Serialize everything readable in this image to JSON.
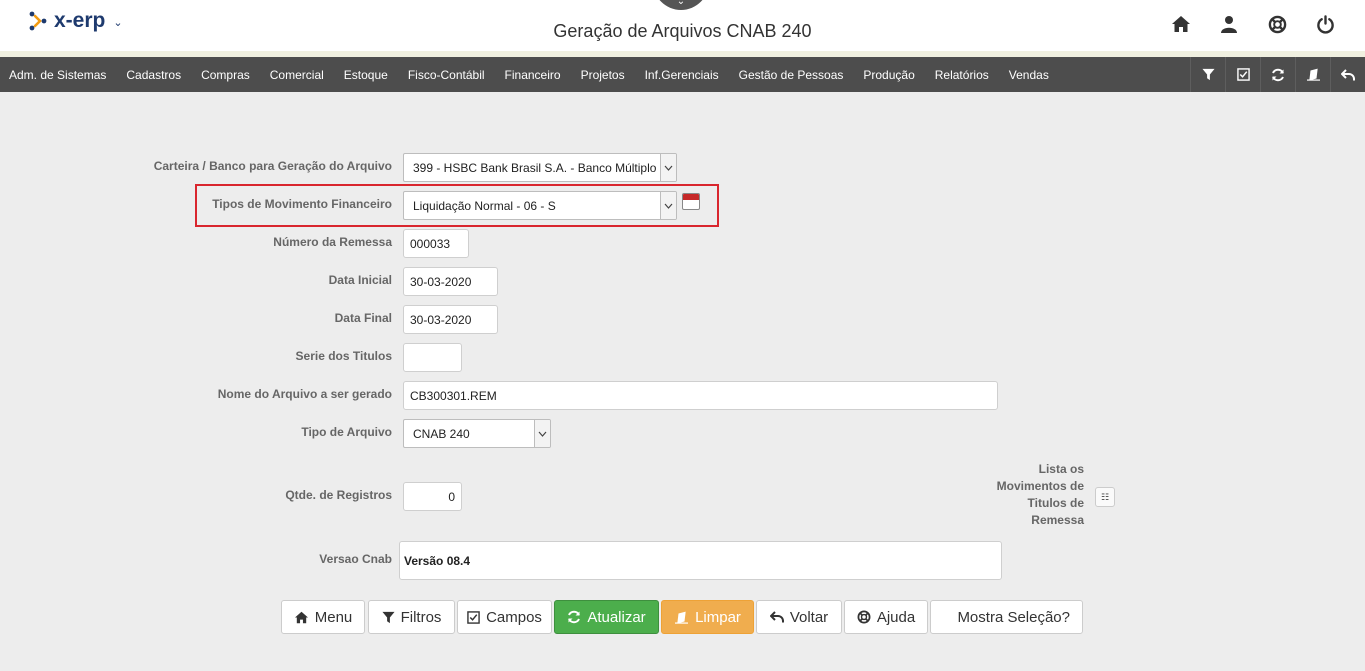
{
  "app": {
    "logo_text": "x-erp",
    "logo_caret": "⌄",
    "page_title": "Geração de Arquivos CNAB 240",
    "top_icons": [
      "home-icon",
      "user-icon",
      "lifebuoy-icon",
      "power-icon"
    ]
  },
  "menu": {
    "items": [
      "Adm. de Sistemas",
      "Cadastros",
      "Compras",
      "Comercial",
      "Estoque",
      "Fisco-Contábil",
      "Financeiro",
      "Projetos",
      "Inf.Gerenciais",
      "Gestão de Pessoas",
      "Produção",
      "Relatórios",
      "Vendas"
    ],
    "tools": [
      "filter-icon",
      "checkbox-icon",
      "refresh-icon",
      "eraser-icon",
      "undo-icon"
    ]
  },
  "form": {
    "carteira_label": "Carteira / Banco para Geração do Arquivo",
    "carteira_value": "399 - HSBC Bank Brasil S.A. - Banco Múltiplo",
    "tipos_label": "Tipos de Movimento Financeiro",
    "tipos_value": "Liquidação Normal - 06 - S",
    "numero_label": "Número da Remessa",
    "numero_value": "000033",
    "data_inicial_label": "Data Inicial",
    "data_inicial_value": "30-03-2020",
    "data_final_label": "Data Final",
    "data_final_value": "30-03-2020",
    "serie_label": "Serie dos Titulos",
    "serie_value": "",
    "nome_label": "Nome do Arquivo a ser gerado",
    "nome_value": "CB300301.REM",
    "tipo_arquivo_label": "Tipo de Arquivo",
    "tipo_arquivo_value": "CNAB 240",
    "qtde_label": "Qtde. de Registros",
    "qtde_value": "0",
    "lista_label": "Lista os Movimentos de Titulos de Remessa",
    "lista_btn": "☷",
    "versao_label": "Versao Cnab",
    "versao_value": "Versão 08.4"
  },
  "buttons": {
    "menu": "Menu",
    "filtros": "Filtros",
    "campos": "Campos",
    "atualizar": "Atualizar",
    "limpar": "Limpar",
    "voltar": "Voltar",
    "ajuda": "Ajuda",
    "mostra": "Mostra Seleção?"
  },
  "colors": {
    "menubar": "#4d4d4d",
    "brand": "#1e3a6e",
    "accent_orange": "#f0ad4e",
    "accent_green": "#4cae4c",
    "highlight": "#d9262e"
  }
}
